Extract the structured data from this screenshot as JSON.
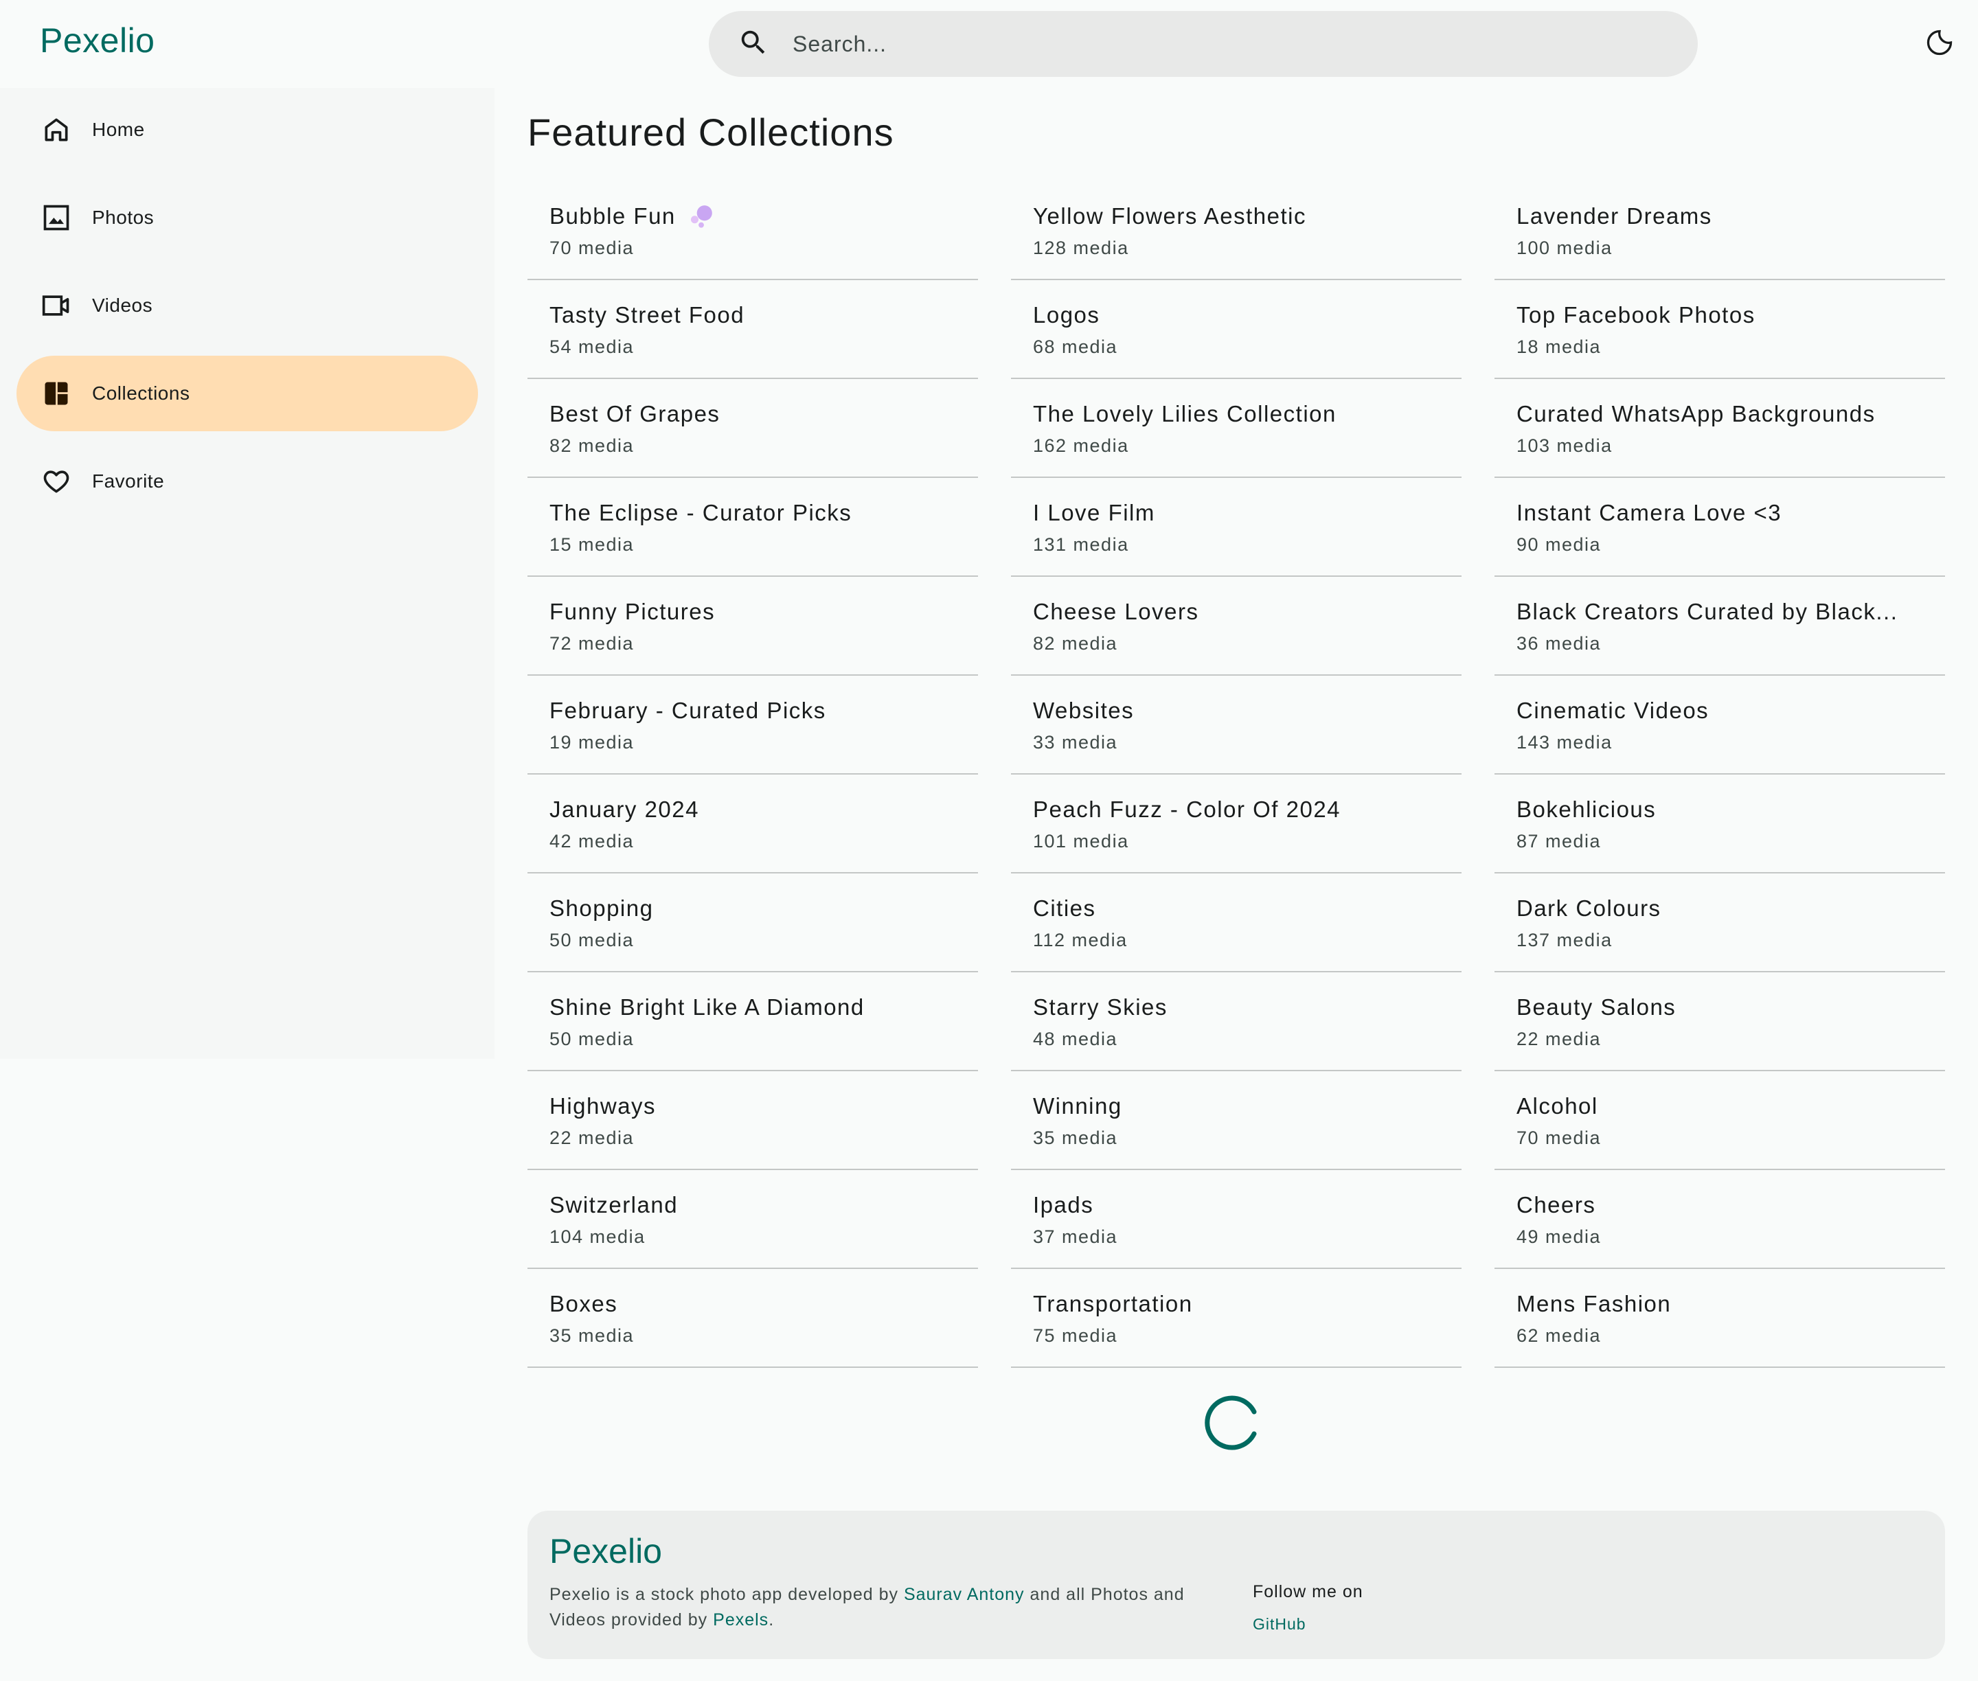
{
  "app": {
    "name": "Pexelio"
  },
  "search": {
    "placeholder": "Search..."
  },
  "sidebar": {
    "items": [
      {
        "label": "Home",
        "icon": "home-icon"
      },
      {
        "label": "Photos",
        "icon": "photo-icon"
      },
      {
        "label": "Videos",
        "icon": "video-icon"
      },
      {
        "label": "Collections",
        "icon": "collections-icon",
        "active": true
      },
      {
        "label": "Favorite",
        "icon": "heart-icon"
      }
    ]
  },
  "main": {
    "title": "Featured Collections",
    "collections": [
      {
        "title": "Bubble Fun",
        "count": "70 media"
      },
      {
        "title": "Yellow Flowers Aesthetic",
        "count": "128 media"
      },
      {
        "title": "Lavender Dreams",
        "count": "100 media"
      },
      {
        "title": "Tasty Street Food",
        "count": "54 media"
      },
      {
        "title": "Logos",
        "count": "68 media"
      },
      {
        "title": "Top Facebook Photos",
        "count": "18 media"
      },
      {
        "title": "Best Of Grapes",
        "count": "82 media"
      },
      {
        "title": "The Lovely Lilies Collection",
        "count": "162 media"
      },
      {
        "title": "Curated WhatsApp Backgrounds",
        "count": "103 media"
      },
      {
        "title": "The Eclipse - Curator Picks",
        "count": "15 media"
      },
      {
        "title": "I Love Film",
        "count": "131 media"
      },
      {
        "title": "Instant Camera Love <3",
        "count": "90 media"
      },
      {
        "title": "Funny Pictures",
        "count": "72 media"
      },
      {
        "title": "Cheese Lovers",
        "count": "82 media"
      },
      {
        "title": "Black Creators Curated by Black...",
        "count": "36 media"
      },
      {
        "title": "February - Curated Picks",
        "count": "19 media"
      },
      {
        "title": "Websites",
        "count": "33 media"
      },
      {
        "title": "Cinematic Videos",
        "count": "143 media"
      },
      {
        "title": "January 2024",
        "count": "42 media"
      },
      {
        "title": "Peach Fuzz - Color Of 2024",
        "count": "101 media"
      },
      {
        "title": "Bokehlicious",
        "count": "87 media"
      },
      {
        "title": "Shopping",
        "count": "50 media"
      },
      {
        "title": "Cities",
        "count": "112 media"
      },
      {
        "title": "Dark Colours",
        "count": "137 media"
      },
      {
        "title": "Shine Bright Like A Diamond",
        "count": "50 media"
      },
      {
        "title": "Starry Skies",
        "count": "48 media"
      },
      {
        "title": "Beauty Salons",
        "count": "22 media"
      },
      {
        "title": "Highways",
        "count": "22 media"
      },
      {
        "title": "Winning",
        "count": "35 media"
      },
      {
        "title": "Alcohol",
        "count": "70 media"
      },
      {
        "title": "Switzerland",
        "count": "104 media"
      },
      {
        "title": "Ipads",
        "count": "37 media"
      },
      {
        "title": "Cheers",
        "count": "49 media"
      },
      {
        "title": "Boxes",
        "count": "35 media"
      },
      {
        "title": "Transportation",
        "count": "75 media"
      },
      {
        "title": "Mens Fashion",
        "count": "62 media"
      }
    ]
  },
  "footer": {
    "logo": "Pexelio",
    "desc_part1": "Pexelio is a stock photo app developed by ",
    "author_link": "Saurav Antony",
    "desc_part2": " and all Photos and Videos provided by ",
    "pexels_link": "Pexels",
    "desc_part3": ".",
    "follow_label": "Follow me on",
    "github_link": "GitHub"
  },
  "colors": {
    "brand": "#006a60",
    "active_nav": "#ffddb2",
    "background": "#f9fbfa",
    "search_bg": "#e8e9e8"
  }
}
